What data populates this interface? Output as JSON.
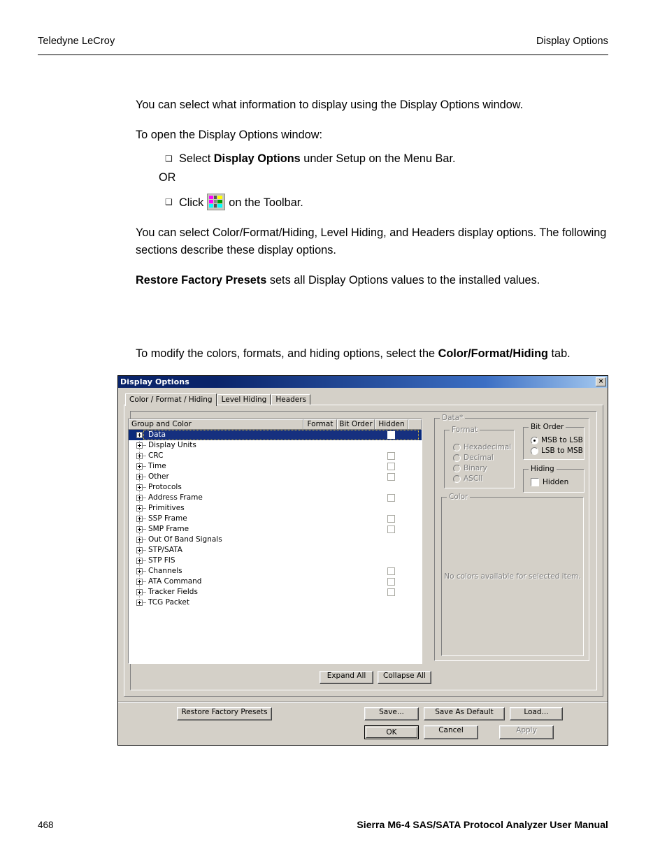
{
  "page": {
    "header_left": "Teledyne LeCroy",
    "header_right": "Display Options",
    "footer_page_number": "468",
    "footer_manual": "Sierra M6-4 SAS/SATA Protocol Analyzer User Manual"
  },
  "prose": {
    "p1": "You can select what information to display using the Display Options window.",
    "p2": "To open the Display Options window:",
    "bullet1_pre": "Select ",
    "bullet1_bold": "Display Options",
    "bullet1_post": " under Setup on the Menu Bar.",
    "or": "OR",
    "bullet2_pre": "Click",
    "bullet2_post": "on the Toolbar.",
    "p3": "You can select Color/Format/Hiding, Level Hiding, and Headers display options. The following sections describe these display options.",
    "p4_bold": "Restore Factory Presets",
    "p4_rest": " sets all Display Options values to the installed values.",
    "p5_pre": "To modify the colors, formats, and hiding options, select the ",
    "p5_bold": "Color/Format/Hiding",
    "p5_post": " tab.",
    "bullet_glyph": "❑"
  },
  "dialog": {
    "title": "Display Options",
    "close_label": "×",
    "tabs": [
      {
        "label": "Color / Format / Hiding",
        "active": true
      },
      {
        "label": "Level Hiding",
        "active": false
      },
      {
        "label": "Headers",
        "active": false
      }
    ],
    "tree": {
      "columns": [
        "Group and Color",
        "Format",
        "Bit Order",
        "Hidden",
        ""
      ],
      "rows": [
        {
          "label": "Data",
          "selected": true,
          "hidden_checkbox": true,
          "checked": false
        },
        {
          "label": "Display Units",
          "selected": false,
          "hidden_checkbox": false,
          "checked": false
        },
        {
          "label": "CRC",
          "selected": false,
          "hidden_checkbox": true,
          "checked": false
        },
        {
          "label": "Time",
          "selected": false,
          "hidden_checkbox": true,
          "checked": false
        },
        {
          "label": "Other",
          "selected": false,
          "hidden_checkbox": true,
          "checked": false
        },
        {
          "label": "Protocols",
          "selected": false,
          "hidden_checkbox": false,
          "checked": false
        },
        {
          "label": "Address Frame",
          "selected": false,
          "hidden_checkbox": true,
          "checked": false
        },
        {
          "label": "Primitives",
          "selected": false,
          "hidden_checkbox": false,
          "checked": false
        },
        {
          "label": "SSP Frame",
          "selected": false,
          "hidden_checkbox": true,
          "checked": false
        },
        {
          "label": "SMP Frame",
          "selected": false,
          "hidden_checkbox": true,
          "checked": false
        },
        {
          "label": "Out Of Band Signals",
          "selected": false,
          "hidden_checkbox": false,
          "checked": false
        },
        {
          "label": "STP/SATA",
          "selected": false,
          "hidden_checkbox": false,
          "checked": false
        },
        {
          "label": "STP FIS",
          "selected": false,
          "hidden_checkbox": false,
          "checked": false
        },
        {
          "label": "Channels",
          "selected": false,
          "hidden_checkbox": true,
          "checked": false
        },
        {
          "label": "ATA Command",
          "selected": false,
          "hidden_checkbox": true,
          "checked": false
        },
        {
          "label": "Tracker Fields",
          "selected": false,
          "hidden_checkbox": true,
          "checked": false
        },
        {
          "label": "TCG Packet",
          "selected": false,
          "hidden_checkbox": false,
          "checked": false
        }
      ]
    },
    "tree_buttons": {
      "expand_all": "Expand All",
      "collapse_all": "Collapse All"
    },
    "data_panel": {
      "caption": "Data*",
      "format": {
        "caption": "Format",
        "enabled": false,
        "options": [
          "Hexadecimal",
          "Decimal",
          "Binary",
          "ASCII"
        ],
        "selected": null
      },
      "bit_order": {
        "caption": "Bit Order",
        "options": [
          "MSB to LSB",
          "LSB to MSB"
        ],
        "selected": "MSB to LSB"
      },
      "hiding": {
        "caption": "Hiding",
        "checkbox_label": "Hidden",
        "checked": false
      },
      "color": {
        "caption": "Color",
        "empty_message": "No colors available for selected item."
      }
    },
    "buttons": {
      "restore": "Restore Factory Presets",
      "save": "Save...",
      "save_as_default": "Save As Default",
      "load": "Load...",
      "ok": "OK",
      "cancel": "Cancel",
      "apply": "Apply",
      "apply_disabled": true
    }
  },
  "colors": {
    "dialog_face": "#d4d0c8",
    "titlebar_start": "#0a246a",
    "titlebar_end": "#a6caf0",
    "selection": "#16307f",
    "disabled_text": "#808080",
    "icon_magenta": "#ff00ff",
    "icon_yellow": "#ffff00",
    "icon_cyan": "#00ffff",
    "icon_green": "#00a000"
  }
}
